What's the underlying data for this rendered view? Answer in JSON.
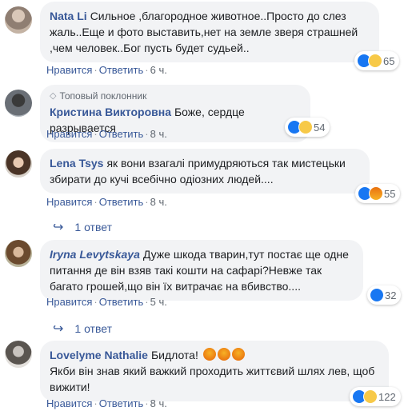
{
  "comments": [
    {
      "author": "Nata Li",
      "badge": "",
      "text": "Сильное ,благородное животное..Просто до слез жаль..Еще и фото выставить,нет на земле зверя страшней ,чем человек..Бог пусть будет судьей..",
      "like_label": "Нравится",
      "reply_label": "Ответить",
      "time": "6 ч.",
      "reactions": [
        "like",
        "sad"
      ],
      "reaction_count": "65",
      "replies": ""
    },
    {
      "author": "Кристина Викторовна",
      "badge": "Топовый поклонник",
      "text": "Боже, сердце разрывается",
      "like_label": "Нравится",
      "reply_label": "Ответить",
      "time": "8 ч.",
      "reactions": [
        "like",
        "sad"
      ],
      "reaction_count": "54",
      "replies": ""
    },
    {
      "author": "Lena Tsys",
      "badge": "",
      "text": "як вони взагалі примудряються так мистецьки збирати до кучі всебічно одіозних людей....",
      "like_label": "Нравится",
      "reply_label": "Ответить",
      "time": "8 ч.",
      "reactions": [
        "like",
        "angry"
      ],
      "reaction_count": "55",
      "replies": "1 ответ"
    },
    {
      "author": "Iryna Levytskaya",
      "badge": "",
      "text": "Дуже шкода тварин,тут постає ще одне питання де він взяв такі кошти на сафарі?Невже так багато грошей,що він їх витрачає на вбивство....",
      "like_label": "Нравится",
      "reply_label": "Ответить",
      "time": "5 ч.",
      "reactions": [
        "like"
      ],
      "reaction_count": "32",
      "replies": "1 ответ"
    },
    {
      "author": "Lovelyme Nathalie",
      "badge": "",
      "text_line1": "Бидлота!",
      "text": "Якби він знав який важкий проходить життєвий шлях лев, щоб вижити!",
      "like_label": "Нравится",
      "reply_label": "Ответить",
      "time": "8 ч.",
      "reactions": [
        "like",
        "sad"
      ],
      "reaction_count": "122",
      "replies": ""
    }
  ],
  "colors": {
    "link": "#385898",
    "bubble": "#f2f3f5",
    "muted": "#606770",
    "like": "#1877f2"
  }
}
